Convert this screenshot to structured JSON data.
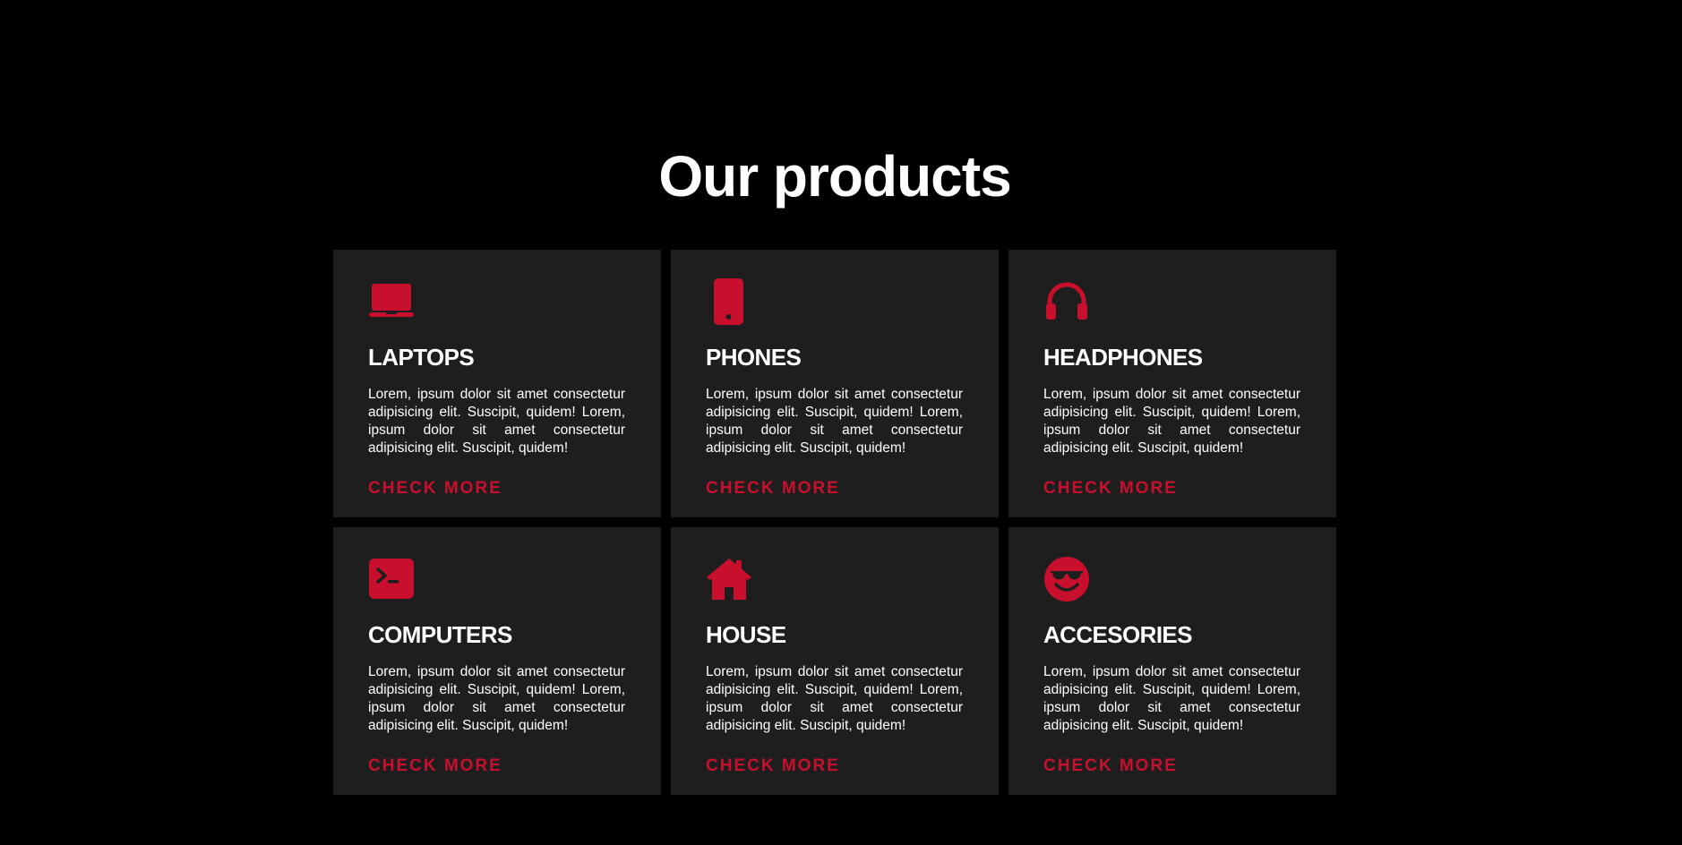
{
  "section": {
    "title": "Our products"
  },
  "theme": {
    "background": "#000000",
    "card_background": "#1e1e1e",
    "accent": "#c8102e",
    "text": "#ffffff"
  },
  "products": [
    {
      "icon": "laptop-icon",
      "title": "LAPTOPS",
      "description": "Lorem, ipsum dolor sit amet consectetur adipisicing elit. Suscipit, quidem! Lorem, ipsum dolor sit amet consectetur adipisicing elit. Suscipit, quidem!",
      "link_label": "CHECK MORE"
    },
    {
      "icon": "mobile-phone-icon",
      "title": "PHONES",
      "description": "Lorem, ipsum dolor sit amet consectetur adipisicing elit. Suscipit, quidem! Lorem, ipsum dolor sit amet consectetur adipisicing elit. Suscipit, quidem!",
      "link_label": "CHECK MORE"
    },
    {
      "icon": "headphones-icon",
      "title": "HEADPHONES",
      "description": "Lorem, ipsum dolor sit amet consectetur adipisicing elit. Suscipit, quidem! Lorem, ipsum dolor sit amet consectetur adipisicing elit. Suscipit, quidem!",
      "link_label": "CHECK MORE"
    },
    {
      "icon": "terminal-icon",
      "title": "COMPUTERS",
      "description": "Lorem, ipsum dolor sit amet consectetur adipisicing elit. Suscipit, quidem! Lorem, ipsum dolor sit amet consectetur adipisicing elit. Suscipit, quidem!",
      "link_label": "CHECK MORE"
    },
    {
      "icon": "house-icon",
      "title": "HOUSE",
      "description": "Lorem, ipsum dolor sit amet consectetur adipisicing elit. Suscipit, quidem! Lorem, ipsum dolor sit amet consectetur adipisicing elit. Suscipit, quidem!",
      "link_label": "CHECK MORE"
    },
    {
      "icon": "smiley-sunglasses-icon",
      "title": "ACCESORIES",
      "description": "Lorem, ipsum dolor sit amet consectetur adipisicing elit. Suscipit, quidem! Lorem, ipsum dolor sit amet consectetur adipisicing elit. Suscipit, quidem!",
      "link_label": "CHECK MORE"
    }
  ]
}
